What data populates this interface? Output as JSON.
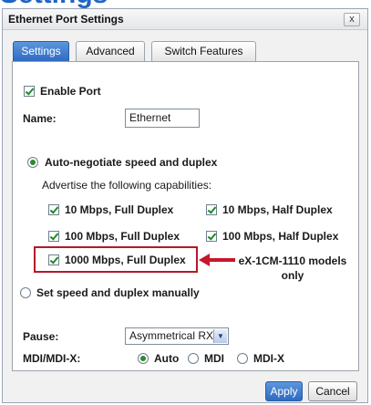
{
  "clipped_heading": "Settings",
  "window": {
    "title": "Ethernet Port Settings",
    "close_glyph": "x"
  },
  "tabs": [
    {
      "label": "Settings",
      "active": true
    },
    {
      "label": "Advanced",
      "active": false
    },
    {
      "label": "Switch Features",
      "active": false
    }
  ],
  "settings": {
    "enable_port": {
      "label": "Enable Port",
      "checked": true
    },
    "name": {
      "label": "Name:",
      "value": "Ethernet"
    },
    "autoneg": {
      "label": "Auto-negotiate speed and duplex",
      "selected": true
    },
    "advertise_label": "Advertise the following capabilities:",
    "capabilities": [
      {
        "label": "10 Mbps, Full Duplex",
        "checked": true
      },
      {
        "label": "10 Mbps, Half Duplex",
        "checked": true
      },
      {
        "label": "100 Mbps, Full Duplex",
        "checked": true
      },
      {
        "label": "100 Mbps, Half Duplex",
        "checked": true
      },
      {
        "label": "1000 Mbps, Full Duplex",
        "checked": true
      }
    ],
    "annotation": "eX-1CM-1110 models only",
    "manual": {
      "label": "Set speed and duplex manually",
      "selected": false
    },
    "pause": {
      "label": "Pause:",
      "value": "Asymmetrical RX"
    },
    "mdi": {
      "label": "MDI/MDI-X:",
      "options": [
        {
          "label": "Auto",
          "selected": true
        },
        {
          "label": "MDI",
          "selected": false
        },
        {
          "label": "MDI-X",
          "selected": false
        }
      ]
    }
  },
  "buttons": {
    "apply": "Apply",
    "cancel": "Cancel"
  },
  "colors": {
    "accent": "#2f6bc3",
    "highlight": "#b5182a",
    "check": "#1a8c2a"
  },
  "icons": {
    "close": "close-icon",
    "dropdown": "chevron-down-icon",
    "arrow": "arrow-left-icon"
  }
}
